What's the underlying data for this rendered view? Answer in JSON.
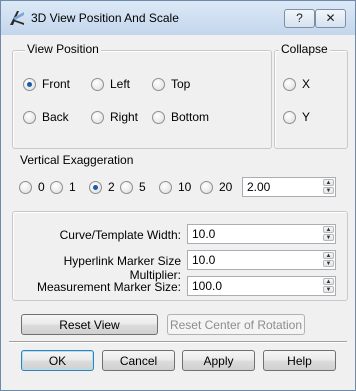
{
  "window": {
    "title": "3D View Position And Scale",
    "help_label": "?",
    "close_label": "✕"
  },
  "view_position": {
    "title": "View Position",
    "options": [
      {
        "label": "Front",
        "checked": true
      },
      {
        "label": "Left",
        "checked": false
      },
      {
        "label": "Top",
        "checked": false
      },
      {
        "label": "Back",
        "checked": false
      },
      {
        "label": "Right",
        "checked": false
      },
      {
        "label": "Bottom",
        "checked": false
      }
    ]
  },
  "collapse": {
    "title": "Collapse",
    "options": [
      {
        "label": "X",
        "checked": false
      },
      {
        "label": "Y",
        "checked": false
      }
    ]
  },
  "vertical_exaggeration": {
    "title": "Vertical Exaggeration",
    "options": [
      {
        "label": "0",
        "checked": false
      },
      {
        "label": "1",
        "checked": false
      },
      {
        "label": "2",
        "checked": true
      },
      {
        "label": "5",
        "checked": false
      },
      {
        "label": "10",
        "checked": false
      },
      {
        "label": "20",
        "checked": false
      }
    ],
    "value": "2.00"
  },
  "settings": {
    "curve_width": {
      "label": "Curve/Template Width:",
      "value": "10.0"
    },
    "hyperlink_multiplier": {
      "label": "Hyperlink Marker Size Multiplier:",
      "value": "10.0"
    },
    "measurement_size": {
      "label": "Measurement Marker Size:",
      "value": "100.0"
    }
  },
  "actions": {
    "reset_view": "Reset View",
    "reset_center": "Reset Center of Rotation"
  },
  "footer": {
    "ok": "OK",
    "cancel": "Cancel",
    "apply": "Apply",
    "help": "Help"
  }
}
